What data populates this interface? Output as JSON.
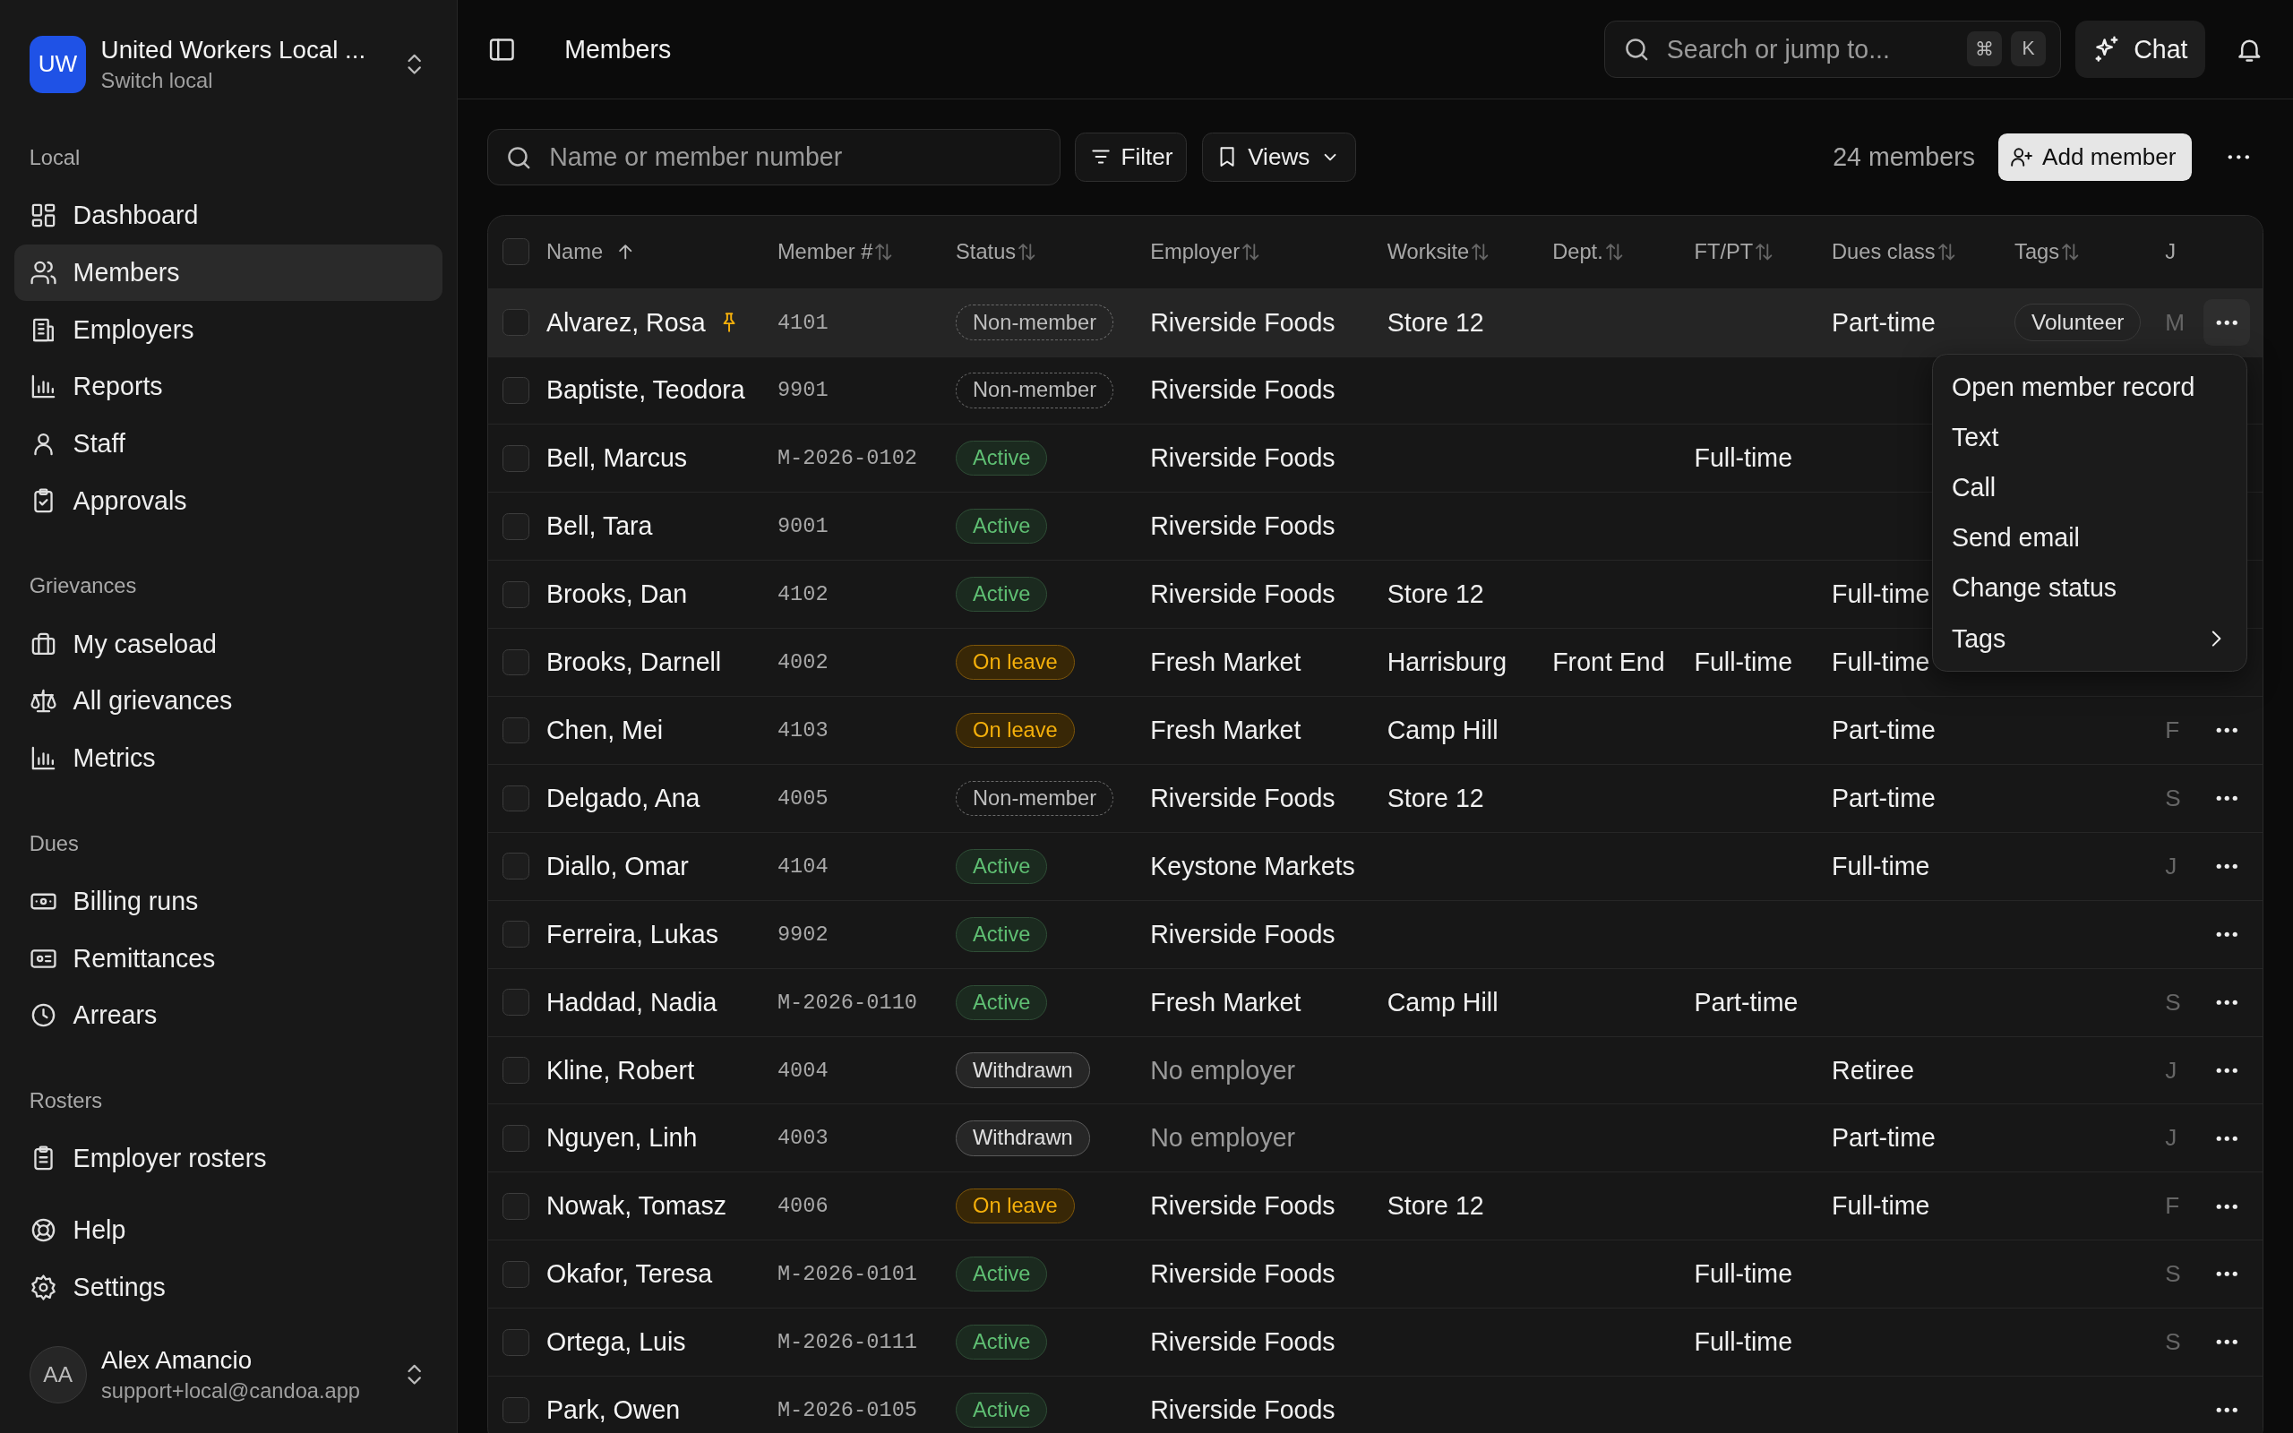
{
  "sidebar": {
    "org": {
      "initials": "UW",
      "name": "United Workers Local ...",
      "subtitle": "Switch local"
    },
    "sections": [
      {
        "title": "Local",
        "items": [
          {
            "label": "Dashboard",
            "selected": false
          },
          {
            "label": "Members",
            "selected": true
          },
          {
            "label": "Employers",
            "selected": false
          },
          {
            "label": "Reports",
            "selected": false
          },
          {
            "label": "Staff",
            "selected": false
          },
          {
            "label": "Approvals",
            "selected": false
          }
        ]
      },
      {
        "title": "Grievances",
        "items": [
          {
            "label": "My caseload",
            "selected": false
          },
          {
            "label": "All grievances",
            "selected": false
          },
          {
            "label": "Metrics",
            "selected": false
          }
        ]
      },
      {
        "title": "Dues",
        "items": [
          {
            "label": "Billing runs",
            "selected": false
          },
          {
            "label": "Remittances",
            "selected": false
          },
          {
            "label": "Arrears",
            "selected": false
          }
        ]
      },
      {
        "title": "Rosters",
        "items": [
          {
            "label": "Employer rosters",
            "selected": false
          }
        ]
      },
      {
        "items": [
          {
            "label": "Help",
            "selected": false
          },
          {
            "label": "Settings",
            "selected": false
          }
        ]
      }
    ],
    "user": {
      "initials": "AA",
      "name": "Alex Amancio",
      "email": "support+local@candoa.app"
    }
  },
  "topbar": {
    "title": "Members",
    "search": {
      "placeholder": "Search or jump to...",
      "keys": [
        "⌘",
        "K"
      ]
    },
    "chat_button": "Chat"
  },
  "toolbar": {
    "search": {
      "placeholder": "Name or member number"
    },
    "filter_button": "Filter",
    "views_button": "Views",
    "count": "24 members",
    "add_button": "Add member"
  },
  "table": {
    "select_all_checked": false,
    "columns": [
      {
        "label": "Name",
        "sorted": true
      },
      {
        "label": "Member #",
        "sorted": false
      },
      {
        "label": "Status",
        "sorted": false
      },
      {
        "label": "Employer",
        "sorted": false
      },
      {
        "label": "Worksite",
        "sorted": false
      },
      {
        "label": "Dept.",
        "sorted": false
      },
      {
        "label": "FT/PT",
        "sorted": false
      },
      {
        "label": "Dues class",
        "sorted": false
      },
      {
        "label": "Tags",
        "sorted": false
      },
      {
        "label": "J"
      }
    ],
    "rows": [
      {
        "checked": false,
        "name": "Alvarez, Rosa",
        "pinned": true,
        "member_no": "4101",
        "status": {
          "label": "Non-member",
          "kind": "non-member"
        },
        "employer": "Riverside Foods",
        "worksite": "Store 12",
        "dues_class": "Part-time",
        "tags": [
          "Volunteer"
        ],
        "column_10": "M",
        "highlighted": true,
        "actions": true,
        "menu_open": true
      },
      {
        "checked": false,
        "name": "Baptiste, Teodora",
        "pinned": false,
        "member_no": "9901",
        "status": {
          "label": "Non-member",
          "kind": "non-member"
        },
        "employer": "Riverside Foods",
        "highlighted": false,
        "actions": false,
        "menu_open": false
      },
      {
        "checked": false,
        "name": "Bell, Marcus",
        "pinned": false,
        "member_no": "M-2026-0102",
        "status": {
          "label": "Active",
          "kind": "active"
        },
        "employer": "Riverside Foods",
        "ft_pt": "Full-time",
        "highlighted": false,
        "actions": false,
        "menu_open": false
      },
      {
        "checked": false,
        "name": "Bell, Tara",
        "pinned": false,
        "member_no": "9001",
        "status": {
          "label": "Active",
          "kind": "active"
        },
        "employer": "Riverside Foods",
        "highlighted": false,
        "actions": false,
        "menu_open": false
      },
      {
        "checked": false,
        "name": "Brooks, Dan",
        "pinned": false,
        "member_no": "4102",
        "status": {
          "label": "Active",
          "kind": "active"
        },
        "employer": "Riverside Foods",
        "worksite": "Store 12",
        "dues_class": "Full-time",
        "highlighted": false,
        "actions": false,
        "menu_open": false
      },
      {
        "checked": false,
        "name": "Brooks, Darnell",
        "pinned": false,
        "member_no": "4002",
        "status": {
          "label": "On leave",
          "kind": "on-leave"
        },
        "employer": "Fresh Market",
        "worksite": "Harrisburg",
        "dept": "Front End",
        "ft_pt": "Full-time",
        "dues_class": "Full-time",
        "highlighted": false,
        "actions": false,
        "menu_open": false
      },
      {
        "checked": false,
        "name": "Chen, Mei",
        "pinned": false,
        "member_no": "4103",
        "status": {
          "label": "On leave",
          "kind": "on-leave"
        },
        "employer": "Fresh Market",
        "worksite": "Camp Hill",
        "dues_class": "Part-time",
        "column_10": "F",
        "highlighted": false,
        "actions": true,
        "menu_open": false
      },
      {
        "checked": false,
        "name": "Delgado, Ana",
        "pinned": false,
        "member_no": "4005",
        "status": {
          "label": "Non-member",
          "kind": "non-member"
        },
        "employer": "Riverside Foods",
        "worksite": "Store 12",
        "dues_class": "Part-time",
        "column_10": "S",
        "highlighted": false,
        "actions": true,
        "menu_open": false
      },
      {
        "checked": false,
        "name": "Diallo, Omar",
        "pinned": false,
        "member_no": "4104",
        "status": {
          "label": "Active",
          "kind": "active"
        },
        "employer": "Keystone Markets",
        "dues_class": "Full-time",
        "column_10": "J",
        "highlighted": false,
        "actions": true,
        "menu_open": false
      },
      {
        "checked": false,
        "name": "Ferreira, Lukas",
        "pinned": false,
        "member_no": "9902",
        "status": {
          "label": "Active",
          "kind": "active"
        },
        "employer": "Riverside Foods",
        "highlighted": false,
        "actions": true,
        "menu_open": false
      },
      {
        "checked": false,
        "name": "Haddad, Nadia",
        "pinned": false,
        "member_no": "M-2026-0110",
        "status": {
          "label": "Active",
          "kind": "active"
        },
        "employer": "Fresh Market",
        "worksite": "Camp Hill",
        "ft_pt": "Part-time",
        "column_10": "S",
        "highlighted": false,
        "actions": true,
        "menu_open": false
      },
      {
        "checked": false,
        "name": "Kline, Robert",
        "pinned": false,
        "member_no": "4004",
        "status": {
          "label": "Withdrawn",
          "kind": "withdrawn"
        },
        "employer": "No employer",
        "employer_missing": true,
        "dues_class": "Retiree",
        "column_10": "J",
        "highlighted": false,
        "actions": true,
        "menu_open": false
      },
      {
        "checked": false,
        "name": "Nguyen, Linh",
        "pinned": false,
        "member_no": "4003",
        "status": {
          "label": "Withdrawn",
          "kind": "withdrawn"
        },
        "employer": "No employer",
        "employer_missing": true,
        "dues_class": "Part-time",
        "column_10": "J",
        "highlighted": false,
        "actions": true,
        "menu_open": false
      },
      {
        "checked": false,
        "name": "Nowak, Tomasz",
        "pinned": false,
        "member_no": "4006",
        "status": {
          "label": "On leave",
          "kind": "on-leave"
        },
        "employer": "Riverside Foods",
        "worksite": "Store 12",
        "dues_class": "Full-time",
        "column_10": "F",
        "highlighted": false,
        "actions": true,
        "menu_open": false
      },
      {
        "checked": false,
        "name": "Okafor, Teresa",
        "pinned": false,
        "member_no": "M-2026-0101",
        "status": {
          "label": "Active",
          "kind": "active"
        },
        "employer": "Riverside Foods",
        "ft_pt": "Full-time",
        "column_10": "S",
        "highlighted": false,
        "actions": true,
        "menu_open": false
      },
      {
        "checked": false,
        "name": "Ortega, Luis",
        "pinned": false,
        "member_no": "M-2026-0111",
        "status": {
          "label": "Active",
          "kind": "active"
        },
        "employer": "Riverside Foods",
        "ft_pt": "Full-time",
        "column_10": "S",
        "highlighted": false,
        "actions": true,
        "menu_open": false
      },
      {
        "checked": false,
        "name": "Park, Owen",
        "pinned": false,
        "member_no": "M-2026-0105",
        "status": {
          "label": "Active",
          "kind": "active"
        },
        "employer": "Riverside Foods",
        "highlighted": false,
        "actions": true,
        "menu_open": false
      }
    ]
  },
  "row_menu": {
    "items": [
      {
        "label": "Open member record",
        "submenu": false
      },
      {
        "label": "Text",
        "submenu": false
      },
      {
        "label": "Call",
        "submenu": false
      },
      {
        "label": "Send email",
        "submenu": false
      },
      {
        "label": "Change status",
        "submenu": false
      },
      {
        "label": "Tags",
        "submenu": true
      }
    ]
  }
}
